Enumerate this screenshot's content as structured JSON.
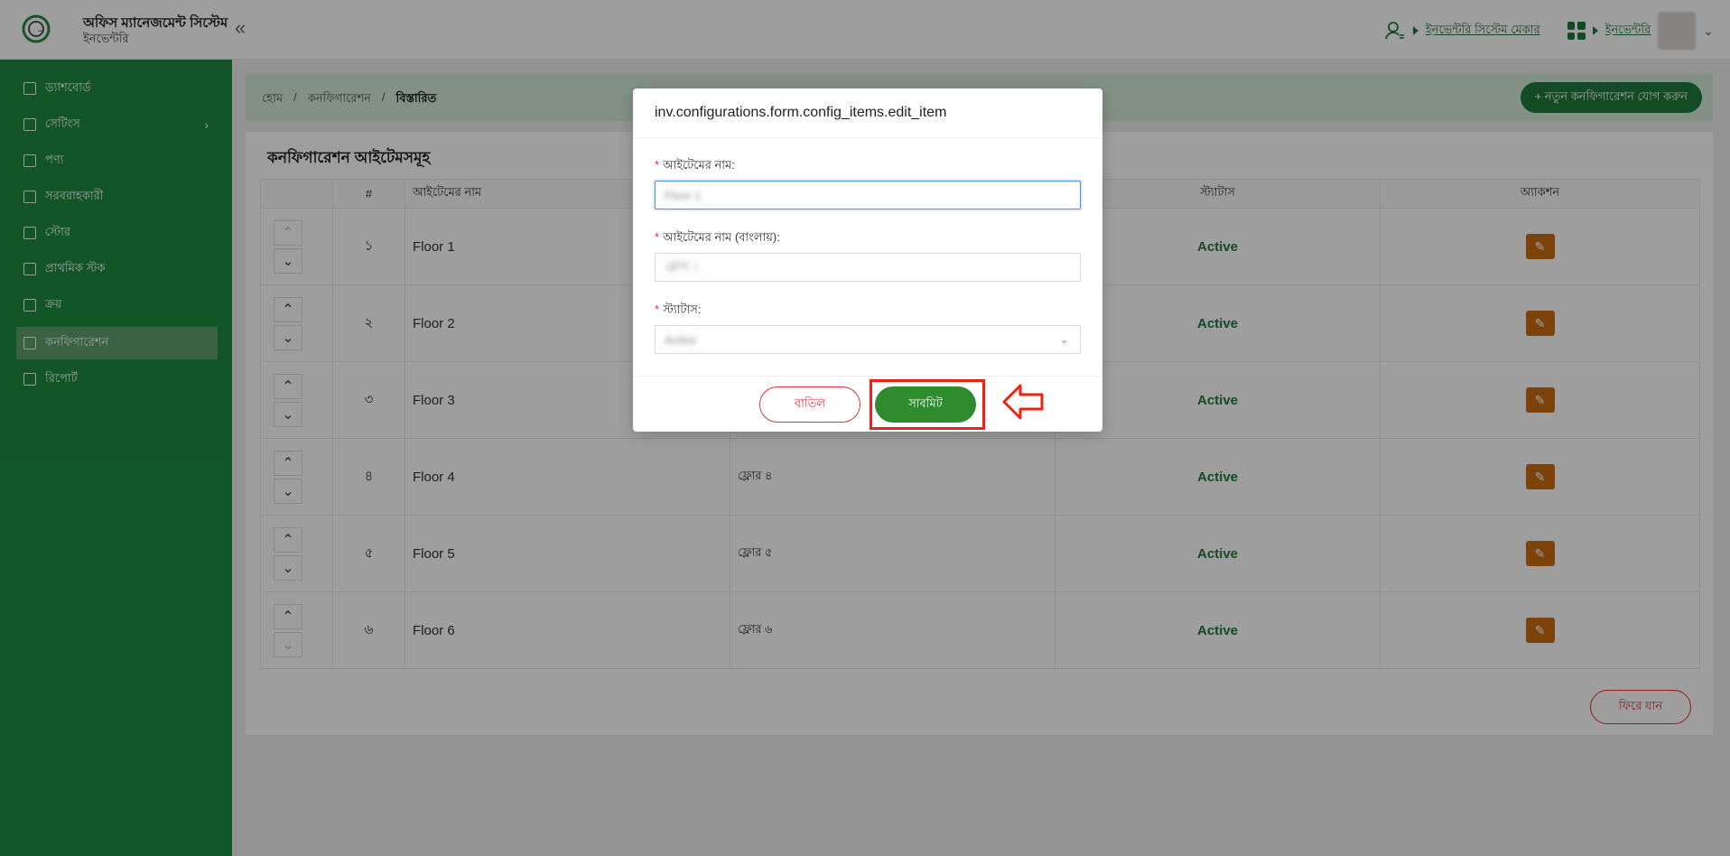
{
  "header": {
    "app_title": "অফিস ম্যানেজমেন্ট সিস্টেম",
    "app_subtitle": "ইনভেন্টরি",
    "collapse_glyph": "«",
    "role_link": "ইনভেন্টরি সিস্টেম মেকার",
    "module_link": "ইনভেন্টরি",
    "chevron": "⌄"
  },
  "sidebar": {
    "items": [
      {
        "label": "ড্যাশবোর্ড"
      },
      {
        "label": "সেটিংস",
        "arrow": "›"
      },
      {
        "label": "পণ্য"
      },
      {
        "label": "সরবরাহকারী"
      },
      {
        "label": "স্টোর"
      },
      {
        "label": "প্রাথমিক স্টক"
      },
      {
        "label": "ক্রয়"
      },
      {
        "label": "কনফিগারেশন"
      },
      {
        "label": "রিপোর্ট"
      }
    ],
    "active_index": 7,
    "bg_color": "#1d8c3f"
  },
  "breadcrumb": {
    "home": "হোম",
    "sep": "/",
    "section": "কনফিগারেশন",
    "current": "বিস্তারিত"
  },
  "add_button": "+ নতুন কনফিগারেশন যোগ করুন",
  "content": {
    "title": "কনফিগারেশন আইটেমসমূহ",
    "columns": [
      "",
      "#",
      "আইটেমের নাম",
      "",
      "স্ট্যাটাস",
      "অ্যাকশন"
    ],
    "rows": [
      {
        "num": "১",
        "name": "Floor 1",
        "name_bn": "",
        "status": "Active"
      },
      {
        "num": "২",
        "name": "Floor 2",
        "name_bn": "",
        "status": "Active"
      },
      {
        "num": "৩",
        "name": "Floor 3",
        "name_bn": "",
        "status": "Active"
      },
      {
        "num": "৪",
        "name": "Floor 4",
        "name_bn": "ফ্লোর ৪",
        "status": "Active"
      },
      {
        "num": "৫",
        "name": "Floor 5",
        "name_bn": "ফ্লোর ৫",
        "status": "Active"
      },
      {
        "num": "৬",
        "name": "Floor 6",
        "name_bn": "ফ্লোর ৬",
        "status": "Active"
      }
    ],
    "back_button": "ফিরে যান"
  },
  "modal": {
    "title": "inv.configurations.form.config_items.edit_item",
    "required_mark": "*",
    "field_name_label": "আইটেমের নাম:",
    "field_name_value": "Floor 1",
    "field_name_bn_label": "আইটেমের নাম (বাংলায়):",
    "field_name_bn_value": "ফ্লোর ১",
    "field_status_label": "স্ট্যাটাস:",
    "field_status_value": "Active",
    "cancel_label": "বাতিল",
    "submit_label": "সাবমিট"
  },
  "icons": {
    "up": "⌃",
    "down": "⌄",
    "edit": "✎",
    "select_arrow": "⌄"
  },
  "colors": {
    "primary": "#1f7a3a",
    "danger": "#dd3333",
    "edit": "#c86f12",
    "highlight": "#ee2211"
  }
}
